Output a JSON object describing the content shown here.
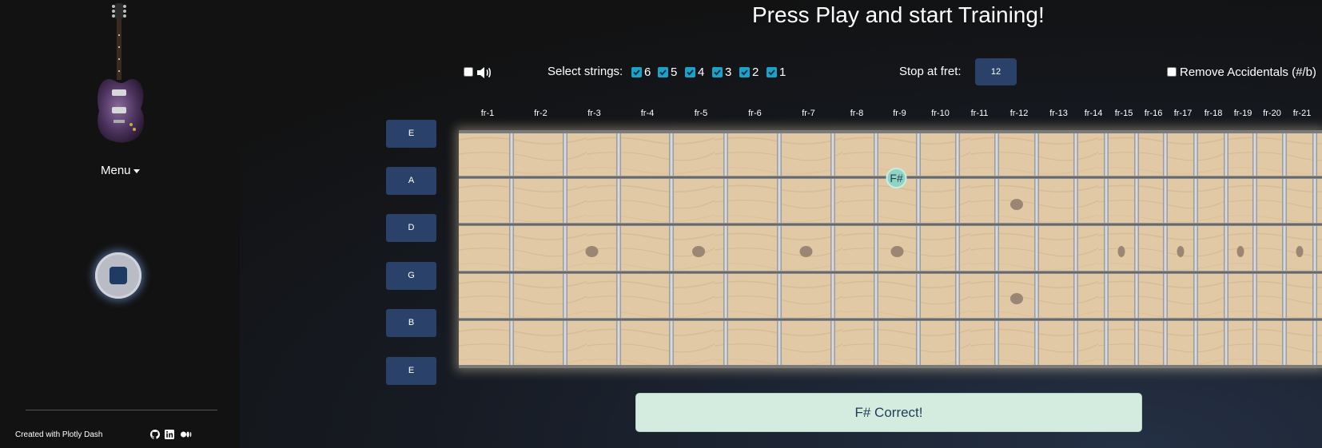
{
  "title": "Press Play and start Training!",
  "sidebar": {
    "menu_label": "Menu",
    "credits": "Created with Plotly Dash",
    "social_icons": [
      "github-icon",
      "linkedin-icon",
      "medium-icon"
    ]
  },
  "controls": {
    "sound_checked": false,
    "strings_label": "Select strings:",
    "strings": [
      {
        "label": "6",
        "checked": true
      },
      {
        "label": "5",
        "checked": true
      },
      {
        "label": "4",
        "checked": true
      },
      {
        "label": "3",
        "checked": true
      },
      {
        "label": "2",
        "checked": true
      },
      {
        "label": "1",
        "checked": true
      }
    ],
    "stop_fret_label": "Stop at fret:",
    "stop_fret_value": "12",
    "accidentals_label": "Remove Accidentals (#/b)",
    "accidentals_checked": false
  },
  "string_buttons": [
    "E",
    "A",
    "D",
    "G",
    "B",
    "E"
  ],
  "fret_labels": [
    "fr-1",
    "fr-2",
    "fr-3",
    "fr-4",
    "fr-5",
    "fr-6",
    "fr-7",
    "fr-8",
    "fr-9",
    "fr-10",
    "fr-11",
    "fr-12",
    "fr-13",
    "fr-14",
    "fr-15",
    "fr-16",
    "fr-17",
    "fr-18",
    "fr-19",
    "fr-20",
    "fr-21"
  ],
  "note_marker": {
    "label": "F#",
    "string": "A",
    "fret": 9
  },
  "inlay_frets_single": [
    3,
    5,
    7,
    9,
    15,
    17,
    19,
    21
  ],
  "inlay_frets_double": [
    12
  ],
  "feedback": "F# Correct!",
  "colors": {
    "button_blue": "#2a4269",
    "checkbox_accent": "#1aa3c7",
    "feedback_bg": "#d4ece0",
    "feedback_text": "#1f3d57",
    "note_marker": "#8fd3c2"
  }
}
